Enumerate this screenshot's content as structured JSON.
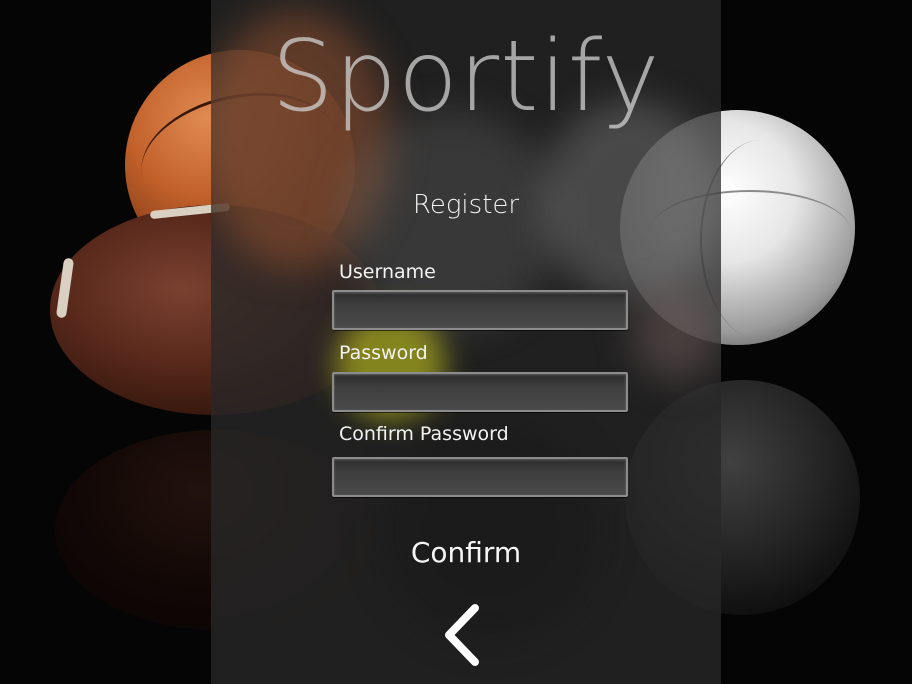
{
  "app": {
    "title": "Sportify"
  },
  "form": {
    "heading": "Register",
    "username": {
      "label": "Username",
      "value": ""
    },
    "password": {
      "label": "Password",
      "value": ""
    },
    "confirm_password": {
      "label": "Confirm Password",
      "value": ""
    },
    "confirm_label": "Confirm"
  },
  "icons": {
    "back": "chevron-left-icon"
  },
  "colors": {
    "text": "#f2f2f2",
    "panel": "#2a2a2a",
    "title": "#d2d2d2"
  }
}
